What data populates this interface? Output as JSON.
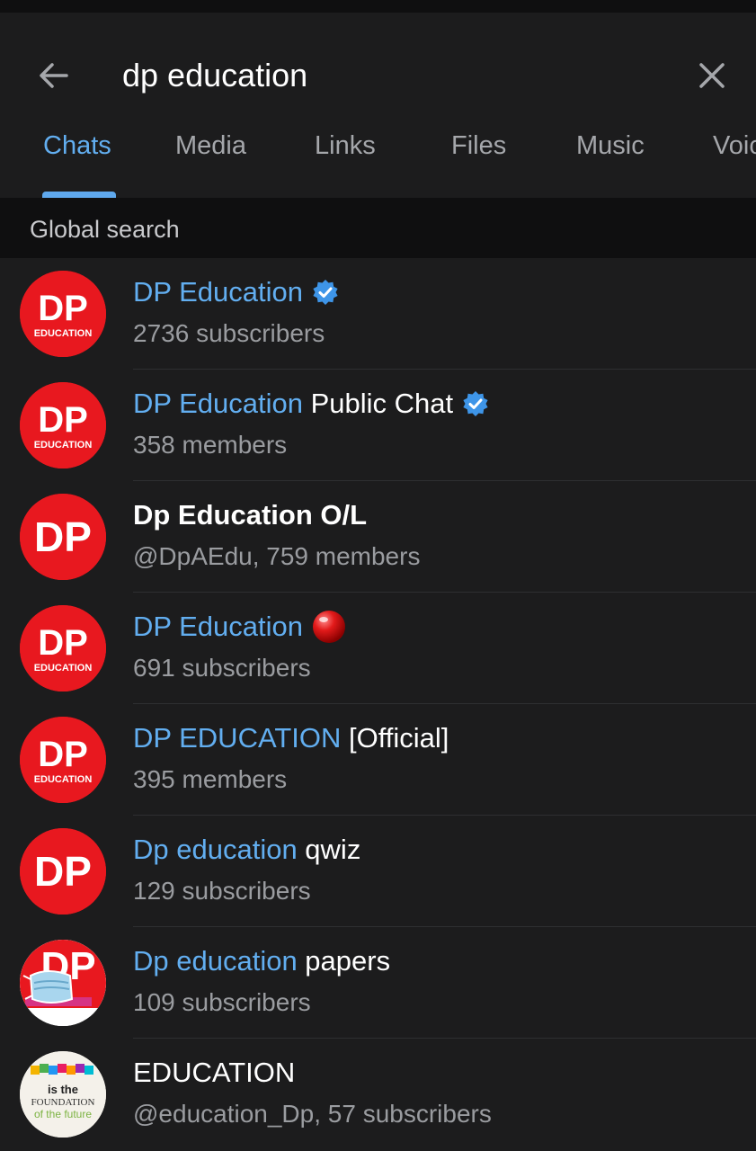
{
  "search": {
    "query": "dp education"
  },
  "tabs": [
    {
      "label": "Chats"
    },
    {
      "label": "Media"
    },
    {
      "label": "Links"
    },
    {
      "label": "Files"
    },
    {
      "label": "Music"
    },
    {
      "label": "Voice"
    }
  ],
  "section": {
    "label": "Global search"
  },
  "results": [
    {
      "title_match": "DP Education",
      "title_rest": "",
      "subtitle": "2736 subscribers",
      "badge": "verified-icon",
      "avatar": "DP EDUCATION"
    },
    {
      "title_match": "DP Education",
      "title_rest": " Public Chat",
      "subtitle": "358 members",
      "badge": "verified-icon",
      "avatar": "DP EDUCATION"
    },
    {
      "title_match": "",
      "title_rest": "Dp Education O/L",
      "subtitle": "@DpAEdu, 759 members",
      "badge": "",
      "avatar": "DP"
    },
    {
      "title_match": "DP Education",
      "title_rest": "",
      "subtitle": "691 subscribers",
      "badge": "red-ball-emoji",
      "avatar": "DP EDUCATION"
    },
    {
      "title_match": "DP EDUCATION",
      "title_rest": " [Official]",
      "subtitle": "395 members",
      "badge": "",
      "avatar": "DP EDUCATION"
    },
    {
      "title_match": "Dp education",
      "title_rest": " qwiz",
      "subtitle": "129 subscribers",
      "badge": "",
      "avatar": "DP"
    },
    {
      "title_match": "Dp education",
      "title_rest": " papers",
      "subtitle": "109 subscribers",
      "badge": "",
      "avatar": "DP masked"
    },
    {
      "title_match": "",
      "title_rest": "EDUCATION",
      "subtitle": "@education_Dp, 57 subscribers",
      "badge": "",
      "avatar": "is the FOUNDATION of the future"
    }
  ],
  "colors": {
    "accent": "#62aef0",
    "background": "#1c1c1d",
    "avatar_red": "#e8181f"
  }
}
